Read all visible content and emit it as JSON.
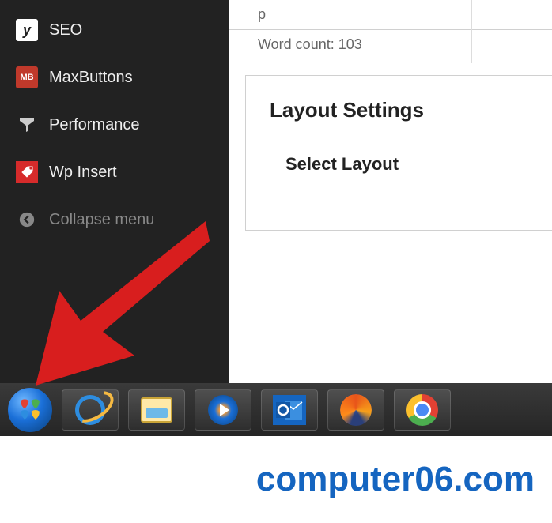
{
  "sidebar": {
    "items": [
      {
        "label": "SEO",
        "icon": "seo-icon"
      },
      {
        "label": "MaxButtons",
        "icon": "maxbuttons-icon"
      },
      {
        "label": "Performance",
        "icon": "performance-icon"
      },
      {
        "label": "Wp Insert",
        "icon": "wp-insert-icon"
      },
      {
        "label": "Collapse menu",
        "icon": "collapse-icon"
      }
    ]
  },
  "editor": {
    "selector": "p",
    "word_count_label": "Word count: 103"
  },
  "layout_box": {
    "heading": "Layout Settings",
    "select_label": "Select Layout"
  },
  "taskbar": {
    "items": [
      {
        "name": "start-button"
      },
      {
        "name": "internet-explorer"
      },
      {
        "name": "file-explorer"
      },
      {
        "name": "windows-media-player"
      },
      {
        "name": "outlook",
        "letter": "o"
      },
      {
        "name": "firefox"
      },
      {
        "name": "chrome"
      }
    ]
  },
  "arrow": {
    "color": "#d81e1e"
  },
  "watermark": "computer06.com"
}
